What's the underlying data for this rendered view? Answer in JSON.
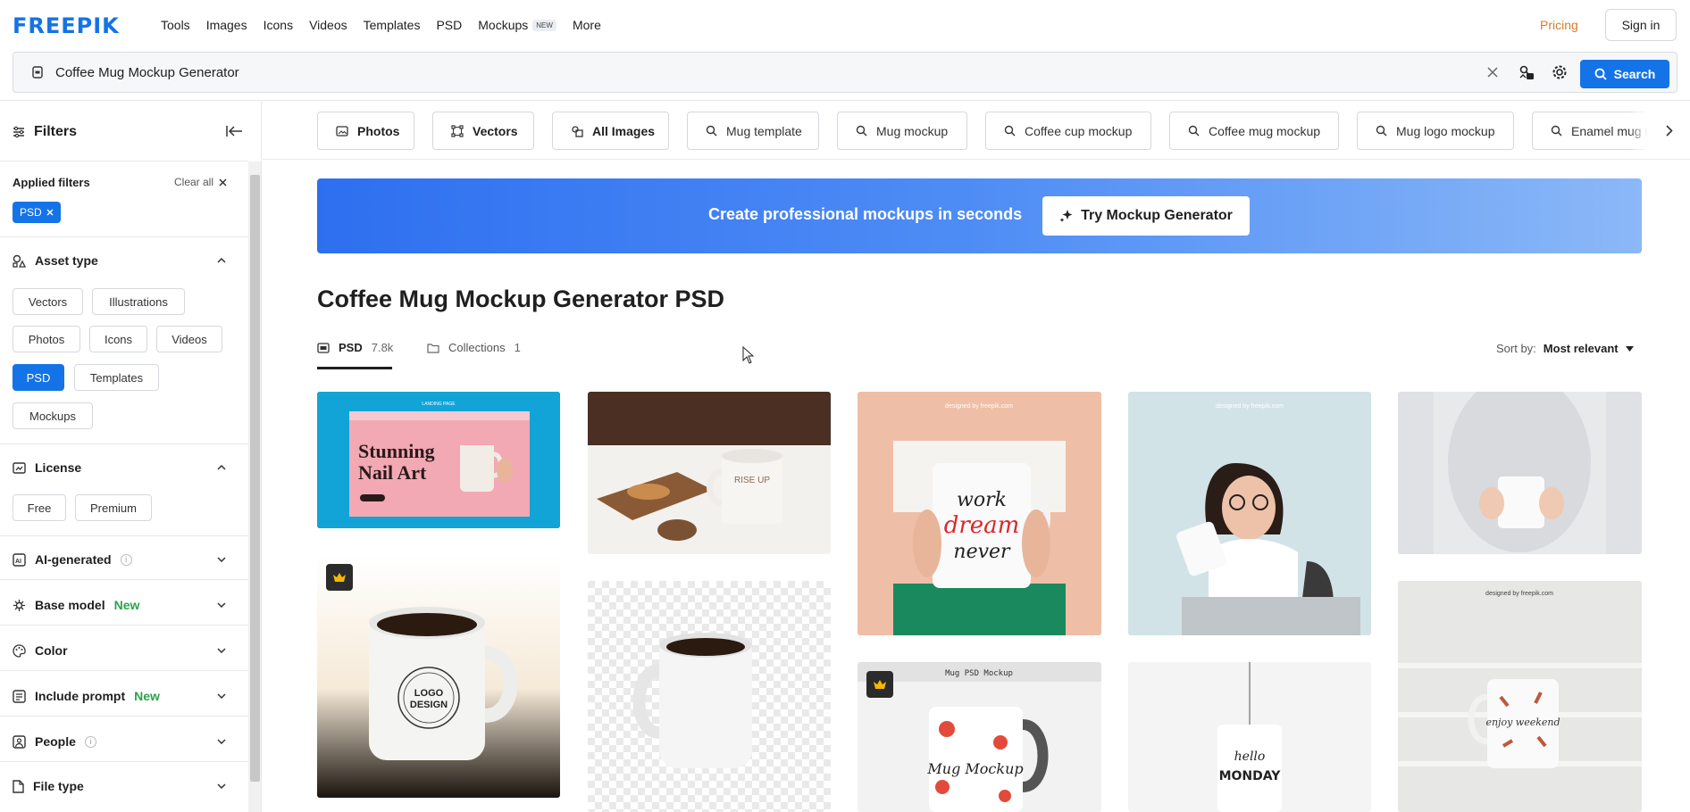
{
  "brand": {
    "logo": "FREEPIK",
    "accent": "#1473e6"
  },
  "nav": {
    "items": [
      {
        "label": "Tools"
      },
      {
        "label": "Images"
      },
      {
        "label": "Icons"
      },
      {
        "label": "Videos"
      },
      {
        "label": "Templates"
      },
      {
        "label": "PSD"
      },
      {
        "label": "Mockups",
        "badge": "NEW"
      },
      {
        "label": "More"
      }
    ],
    "pricing": "Pricing",
    "signin": "Sign in"
  },
  "search": {
    "value": "Coffee Mug Mockup Generator",
    "button": "Search"
  },
  "sidebar": {
    "title": "Filters",
    "applied_label": "Applied filters",
    "clear_all": "Clear all",
    "applied_chip": "PSD",
    "asset_type": {
      "label": "Asset type",
      "options": [
        "Vectors",
        "Illustrations",
        "Photos",
        "Icons",
        "Videos",
        "PSD",
        "Templates",
        "Mockups"
      ],
      "selected": "PSD"
    },
    "license": {
      "label": "License",
      "options": [
        "Free",
        "Premium"
      ]
    },
    "ai_generated": "AI-generated",
    "base_model": {
      "label": "Base model",
      "tag": "New"
    },
    "color": "Color",
    "include_prompt": {
      "label": "Include prompt",
      "tag": "New"
    },
    "people": "People",
    "file_type": "File type"
  },
  "chips": [
    {
      "label": "Photos",
      "icon": "image-icon",
      "bold": true
    },
    {
      "label": "Vectors",
      "icon": "vector-icon",
      "bold": true
    },
    {
      "label": "All Images",
      "icon": "images-icon",
      "bold": true
    },
    {
      "label": "Mug template",
      "icon": "search-icon"
    },
    {
      "label": "Mug mockup",
      "icon": "search-icon"
    },
    {
      "label": "Coffee cup mockup",
      "icon": "search-icon"
    },
    {
      "label": "Coffee mug mockup",
      "icon": "search-icon"
    },
    {
      "label": "Mug logo mockup",
      "icon": "search-icon"
    },
    {
      "label": "Enamel mug mockup",
      "icon": "search-icon"
    }
  ],
  "banner": {
    "text": "Create professional mockups in seconds",
    "button": "Try Mockup Generator"
  },
  "results": {
    "title": "Coffee Mug Mockup Generator PSD",
    "tabs": [
      {
        "label": "PSD",
        "count": "7.8k"
      },
      {
        "label": "Collections",
        "count": "1"
      }
    ],
    "sort_label": "Sort by:",
    "sort_value": "Most relevant"
  },
  "grid": [
    {
      "name": "nail-art-landing-mockup",
      "heading": "LANDING PAGE",
      "text1": "Stunning",
      "text2": "Nail Art",
      "premium": false
    },
    {
      "name": "rise-up-mug-croissant",
      "mug_text": "RISE UP",
      "premium": false
    },
    {
      "name": "work-dream-never-mug",
      "mug_text1": "work",
      "mug_text2": "dream",
      "mug_text3": "never",
      "watermark": "designed by freepik.com",
      "premium": false
    },
    {
      "name": "woman-drinking-mug",
      "watermark": "designed by freepik.com",
      "premium": false
    },
    {
      "name": "hands-holding-white-mug",
      "premium": false
    },
    {
      "name": "logo-design-mug",
      "logo1": "LOGO",
      "logo2": "DESIGN",
      "premium": true
    },
    {
      "name": "white-mug-transparent",
      "premium": false
    },
    {
      "name": "mug-psd-mockup-floral",
      "header": "Mug PSD Mockup",
      "mug_text": "Mug Mockup",
      "premium": true
    },
    {
      "name": "hello-monday-mug",
      "mug_text1": "hello",
      "mug_text2": "MONDAY",
      "premium": false
    },
    {
      "name": "enjoy-weekend-mug",
      "mug_text": "enjoy weekend",
      "watermark": "designed by freepik.com",
      "premium": false
    }
  ]
}
